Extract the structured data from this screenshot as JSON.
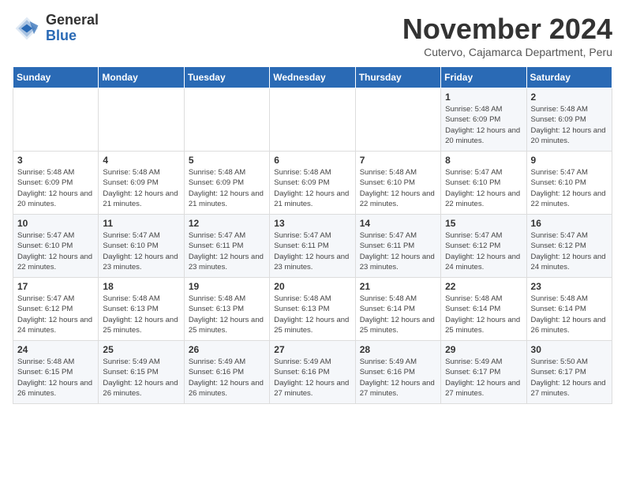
{
  "logo": {
    "general": "General",
    "blue": "Blue"
  },
  "title": "November 2024",
  "subtitle": "Cutervo, Cajamarca Department, Peru",
  "days_of_week": [
    "Sunday",
    "Monday",
    "Tuesday",
    "Wednesday",
    "Thursday",
    "Friday",
    "Saturday"
  ],
  "weeks": [
    [
      {
        "day": "",
        "info": ""
      },
      {
        "day": "",
        "info": ""
      },
      {
        "day": "",
        "info": ""
      },
      {
        "day": "",
        "info": ""
      },
      {
        "day": "",
        "info": ""
      },
      {
        "day": "1",
        "info": "Sunrise: 5:48 AM\nSunset: 6:09 PM\nDaylight: 12 hours and 20 minutes."
      },
      {
        "day": "2",
        "info": "Sunrise: 5:48 AM\nSunset: 6:09 PM\nDaylight: 12 hours and 20 minutes."
      }
    ],
    [
      {
        "day": "3",
        "info": "Sunrise: 5:48 AM\nSunset: 6:09 PM\nDaylight: 12 hours and 20 minutes."
      },
      {
        "day": "4",
        "info": "Sunrise: 5:48 AM\nSunset: 6:09 PM\nDaylight: 12 hours and 21 minutes."
      },
      {
        "day": "5",
        "info": "Sunrise: 5:48 AM\nSunset: 6:09 PM\nDaylight: 12 hours and 21 minutes."
      },
      {
        "day": "6",
        "info": "Sunrise: 5:48 AM\nSunset: 6:09 PM\nDaylight: 12 hours and 21 minutes."
      },
      {
        "day": "7",
        "info": "Sunrise: 5:48 AM\nSunset: 6:10 PM\nDaylight: 12 hours and 22 minutes."
      },
      {
        "day": "8",
        "info": "Sunrise: 5:47 AM\nSunset: 6:10 PM\nDaylight: 12 hours and 22 minutes."
      },
      {
        "day": "9",
        "info": "Sunrise: 5:47 AM\nSunset: 6:10 PM\nDaylight: 12 hours and 22 minutes."
      }
    ],
    [
      {
        "day": "10",
        "info": "Sunrise: 5:47 AM\nSunset: 6:10 PM\nDaylight: 12 hours and 22 minutes."
      },
      {
        "day": "11",
        "info": "Sunrise: 5:47 AM\nSunset: 6:10 PM\nDaylight: 12 hours and 23 minutes."
      },
      {
        "day": "12",
        "info": "Sunrise: 5:47 AM\nSunset: 6:11 PM\nDaylight: 12 hours and 23 minutes."
      },
      {
        "day": "13",
        "info": "Sunrise: 5:47 AM\nSunset: 6:11 PM\nDaylight: 12 hours and 23 minutes."
      },
      {
        "day": "14",
        "info": "Sunrise: 5:47 AM\nSunset: 6:11 PM\nDaylight: 12 hours and 23 minutes."
      },
      {
        "day": "15",
        "info": "Sunrise: 5:47 AM\nSunset: 6:12 PM\nDaylight: 12 hours and 24 minutes."
      },
      {
        "day": "16",
        "info": "Sunrise: 5:47 AM\nSunset: 6:12 PM\nDaylight: 12 hours and 24 minutes."
      }
    ],
    [
      {
        "day": "17",
        "info": "Sunrise: 5:47 AM\nSunset: 6:12 PM\nDaylight: 12 hours and 24 minutes."
      },
      {
        "day": "18",
        "info": "Sunrise: 5:48 AM\nSunset: 6:13 PM\nDaylight: 12 hours and 25 minutes."
      },
      {
        "day": "19",
        "info": "Sunrise: 5:48 AM\nSunset: 6:13 PM\nDaylight: 12 hours and 25 minutes."
      },
      {
        "day": "20",
        "info": "Sunrise: 5:48 AM\nSunset: 6:13 PM\nDaylight: 12 hours and 25 minutes."
      },
      {
        "day": "21",
        "info": "Sunrise: 5:48 AM\nSunset: 6:14 PM\nDaylight: 12 hours and 25 minutes."
      },
      {
        "day": "22",
        "info": "Sunrise: 5:48 AM\nSunset: 6:14 PM\nDaylight: 12 hours and 25 minutes."
      },
      {
        "day": "23",
        "info": "Sunrise: 5:48 AM\nSunset: 6:14 PM\nDaylight: 12 hours and 26 minutes."
      }
    ],
    [
      {
        "day": "24",
        "info": "Sunrise: 5:48 AM\nSunset: 6:15 PM\nDaylight: 12 hours and 26 minutes."
      },
      {
        "day": "25",
        "info": "Sunrise: 5:49 AM\nSunset: 6:15 PM\nDaylight: 12 hours and 26 minutes."
      },
      {
        "day": "26",
        "info": "Sunrise: 5:49 AM\nSunset: 6:16 PM\nDaylight: 12 hours and 26 minutes."
      },
      {
        "day": "27",
        "info": "Sunrise: 5:49 AM\nSunset: 6:16 PM\nDaylight: 12 hours and 27 minutes."
      },
      {
        "day": "28",
        "info": "Sunrise: 5:49 AM\nSunset: 6:16 PM\nDaylight: 12 hours and 27 minutes."
      },
      {
        "day": "29",
        "info": "Sunrise: 5:49 AM\nSunset: 6:17 PM\nDaylight: 12 hours and 27 minutes."
      },
      {
        "day": "30",
        "info": "Sunrise: 5:50 AM\nSunset: 6:17 PM\nDaylight: 12 hours and 27 minutes."
      }
    ]
  ]
}
